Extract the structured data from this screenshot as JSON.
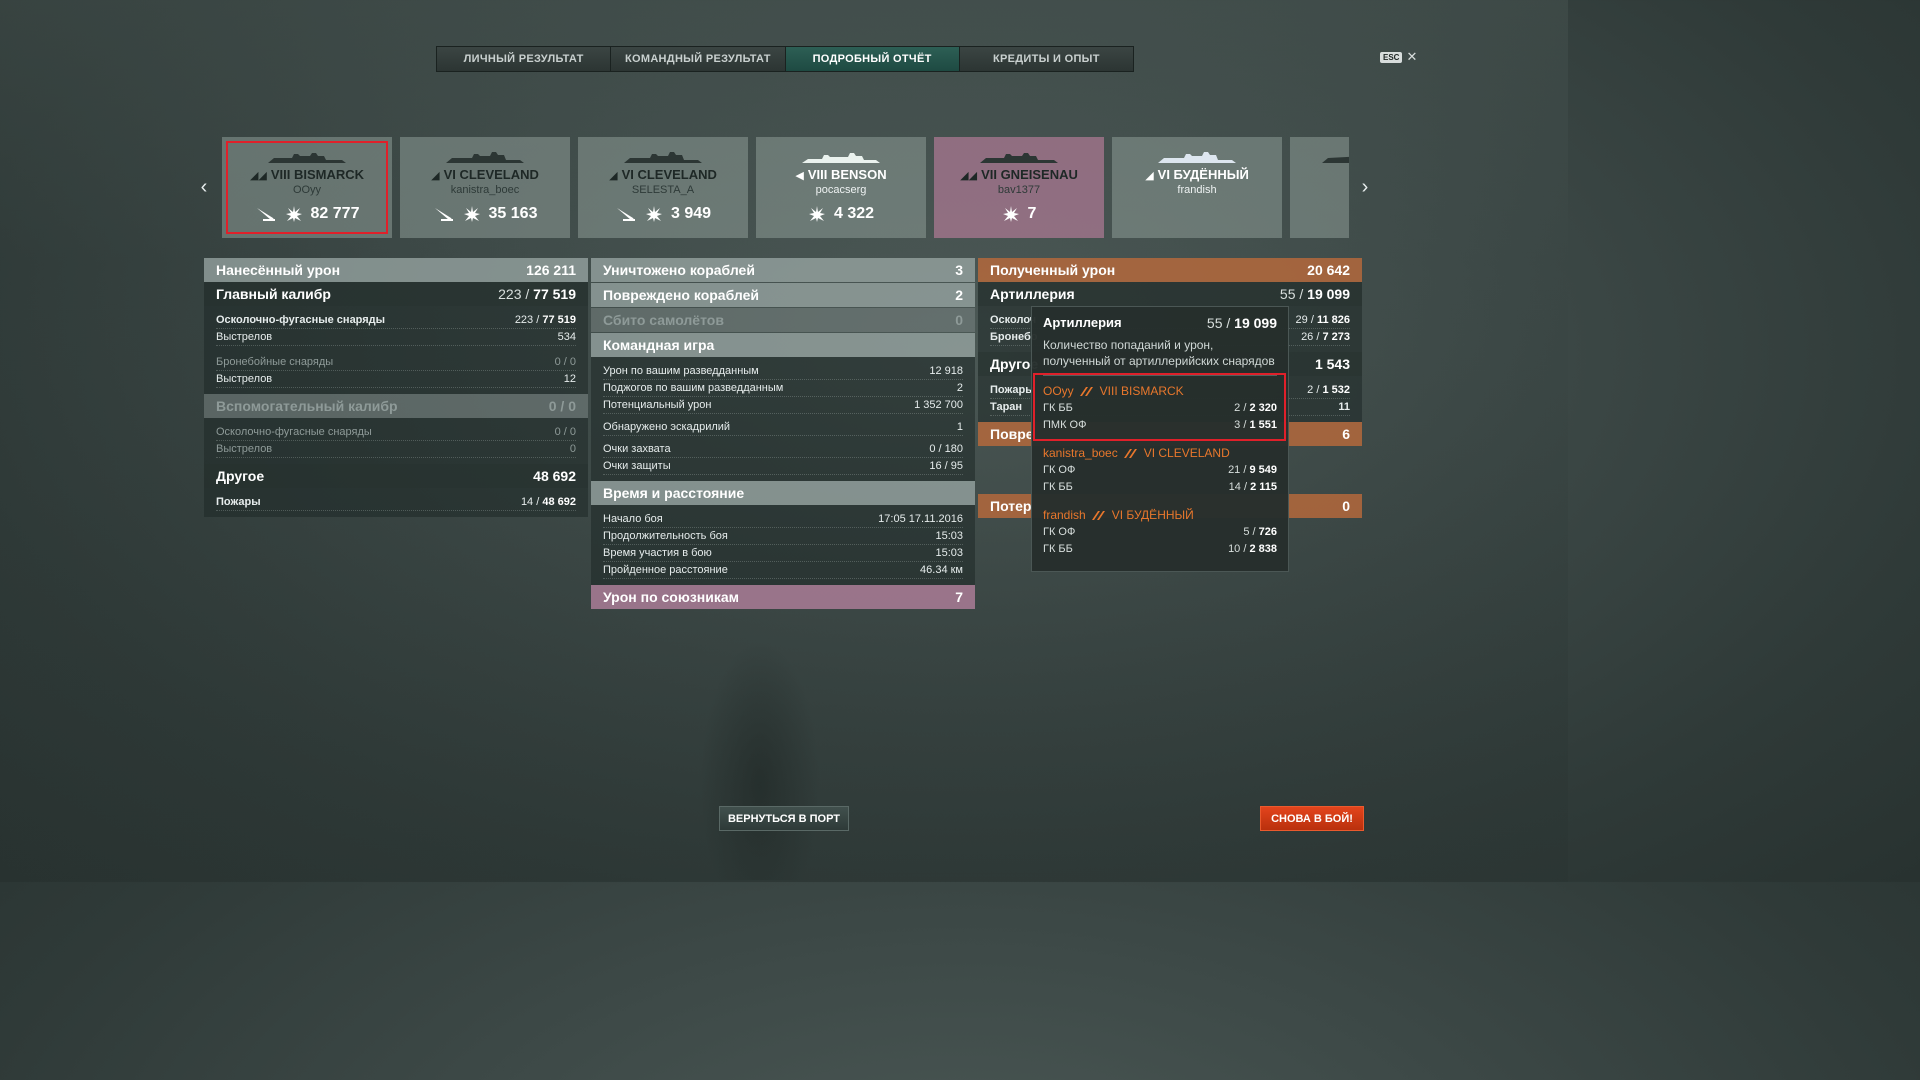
{
  "tabs": [
    {
      "label": "ЛИЧНЫЙ РЕЗУЛЬТАТ",
      "active": false
    },
    {
      "label": "КОМАНДНЫЙ РЕЗУЛЬТАТ",
      "active": false
    },
    {
      "label": "ПОДРОБНЫЙ ОТЧЁТ",
      "active": true
    },
    {
      "label": "КРЕДИТЫ И ОПЫТ",
      "active": false
    }
  ],
  "esc_label": "ESC",
  "ships": [
    {
      "tier_name": "VIII BISMARCK",
      "player": "OOyy",
      "value": "82 777",
      "selected": true
    },
    {
      "tier_name": "VI CLEVELAND",
      "player": "kanistra_boec",
      "value": "35 163"
    },
    {
      "tier_name": "VI CLEVELAND",
      "player": "SELESTA_A",
      "value": "3 949"
    },
    {
      "tier_name": "VIII BENSON",
      "player": "pocacserg",
      "value": "4 322"
    },
    {
      "tier_name": "VII GNEISENAU",
      "player": "bav1377",
      "value": "7"
    },
    {
      "tier_name": "VI БУДЁННЫЙ",
      "player": "frandish",
      "value": ""
    }
  ],
  "left": {
    "dealt": {
      "label": "Нанесённый урон",
      "value": "126 211"
    },
    "main": {
      "label": "Главный калибр",
      "value_a": "223 / ",
      "value_b": "77 519"
    },
    "he_label": "Осколочно-фугасные снаряды",
    "he_a": "223 / ",
    "he_b": "77 519",
    "shots_label": "Выстрелов",
    "shots_val": "534",
    "ap_label": "Бронебойные снаряды",
    "ap_val": "0 / 0",
    "ap_shots_label": "Выстрелов",
    "ap_shots_val": "12",
    "secondary": {
      "label": "Вспомогательный калибр",
      "value": "0 / 0"
    },
    "sec_he_label": "Осколочно-фугасные снаряды",
    "sec_he_val": "0 / 0",
    "sec_shots_label": "Выстрелов",
    "sec_shots_val": "0",
    "other": {
      "label": "Другое",
      "value": "48 692"
    },
    "fires_label": "Пожары",
    "fires_a": "14 / ",
    "fires_b": "48 692"
  },
  "mid": {
    "destroyed": {
      "label": "Уничтожено кораблей",
      "value": "3"
    },
    "damaged": {
      "label": "Повреждено кораблей",
      "value": "2"
    },
    "planes": {
      "label": "Сбито самолётов",
      "value": "0"
    },
    "team": {
      "label": "Командная игра"
    },
    "team_rows": [
      {
        "label": "Урон по вашим разведданным",
        "value": "12 918"
      },
      {
        "label": "Поджогов по вашим разведданным",
        "value": "2"
      },
      {
        "label": "Потенциальный урон",
        "value": "1 352 700"
      },
      {
        "label": "Обнаружено эскадрилий",
        "value": "1"
      },
      {
        "label": "Очки захвата",
        "value": "0 / 180"
      },
      {
        "label": "Очки защиты",
        "value": "16 / 95"
      }
    ],
    "time": {
      "label": "Время и расстояние"
    },
    "time_rows": [
      {
        "label": "Начало боя",
        "value": "17:05  17.11.2016"
      },
      {
        "label": "Продолжительность боя",
        "value": "15:03"
      },
      {
        "label": "Время участия в бою",
        "value": "15:03"
      },
      {
        "label": "Пройденное расстояние",
        "value": "46.34 км"
      }
    ],
    "allies": {
      "label": "Урон по союзникам",
      "value": "7"
    }
  },
  "right": {
    "received": {
      "label": "Полученный урон",
      "value": "20 642"
    },
    "artillery": {
      "label": "Артиллерия",
      "value_a": "55 / ",
      "value_b": "19 099"
    },
    "r1_label": "Осколоч",
    "r1_a": "29 / ",
    "r1_b": "11 826",
    "r2_label": "Бронебо",
    "r2_a": "26 / ",
    "r2_b": "7 273",
    "other": {
      "label": "Другое",
      "value": "1 543"
    },
    "r3_label": "Пожары",
    "r3_a": "2 / ",
    "r3_b": "1 532",
    "r4_label": "Таран",
    "r4_val": "11",
    "spotted": {
      "label": "Повре",
      "value": "6"
    },
    "potential": {
      "label": "Потер",
      "value": "0"
    }
  },
  "tooltip": {
    "title": "Артиллерия",
    "value_a": "55 / ",
    "value_b": "19 099",
    "description": "Количество попаданий и урон, полученный от артиллерийских снарядов",
    "groups": [
      {
        "player": "OOyy",
        "ship": "VIII BISMARCK",
        "rows": [
          {
            "label": "ГК ББ",
            "a": "2 / ",
            "b": "2 320"
          },
          {
            "label": "ПМК ОФ",
            "a": "3 / ",
            "b": "1 551"
          }
        ]
      },
      {
        "player": "kanistra_boec",
        "ship": "VI CLEVELAND",
        "rows": [
          {
            "label": "ГК ОФ",
            "a": "21 / ",
            "b": "9 549"
          },
          {
            "label": "ГК ББ",
            "a": "14 / ",
            "b": "2 115"
          }
        ]
      },
      {
        "player": "frandish",
        "ship": "VI БУДЁННЫЙ",
        "rows": [
          {
            "label": "ГК ОФ",
            "a": "5 / ",
            "b": "726"
          },
          {
            "label": "ГК ББ",
            "a": "10 / ",
            "b": "2 838"
          }
        ]
      }
    ]
  },
  "buttons": {
    "port": "ВЕРНУТЬСЯ В ПОРТ",
    "battle": "СНОВА В БОЙ!"
  },
  "colors": {
    "accent_orange": "#e8772c",
    "battle_button": "#d63a15",
    "highlight_red": "#e0202a",
    "tab_active": "#1e4a42"
  }
}
